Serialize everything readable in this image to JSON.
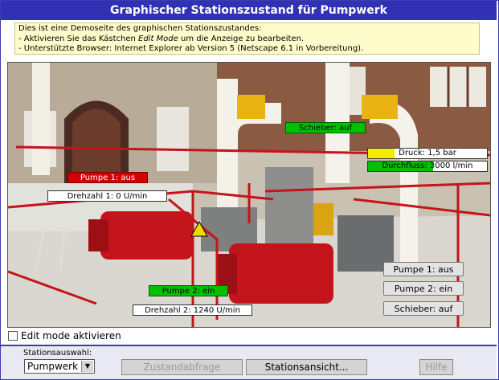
{
  "title": "Graphischer Stationszustand für Pumpwerk",
  "info": {
    "line1": "Dies ist eine Demoseite des graphischen Stationszustandes:",
    "line2_prefix": "- Aktivieren Sie das Kästchen ",
    "line2_em": "Edit Mode",
    "line2_suffix": " um die Anzeige zu bearbeiten.",
    "line3": "- Unterstützte Browser: Internet Explorer ab Version 5 (Netscape 6.1 in Vorbereitung)."
  },
  "overlays": {
    "schieber_status": "Schieber: auf",
    "pumpe1_status": "Pumpe 1: aus",
    "drehzahl1": "Drehzahl 1: 0 U/min",
    "druck": "Druck: 1,5 bar",
    "druck_level": 0.22,
    "durchfluss": "Durchfluss: 3000 l/min",
    "durchfluss_level": 0.55,
    "pumpe2_status": "Pumpe 2: ein",
    "drehzahl2": "Drehzahl 2: 1240 U/min"
  },
  "control_buttons": {
    "pumpe1": "Pumpe 1: aus",
    "pumpe2": "Pumpe 2: ein",
    "schieber": "Schieber: auf"
  },
  "edit_mode": {
    "label": "Edit mode aktivieren",
    "checked": false
  },
  "footer": {
    "station_label": "Stationsauswahl:",
    "station_value": "Pumpwerk",
    "zustandabfrage": "Zustandabfrage",
    "stationsansicht": "Stationsansicht...",
    "hilfe": "Hilfe"
  },
  "colors": {
    "title_bg": "#3131b5",
    "status_red": "#d40000",
    "status_green": "#00c000",
    "pressure_yellow": "#f4ec00",
    "info_bg": "#fffccc"
  }
}
